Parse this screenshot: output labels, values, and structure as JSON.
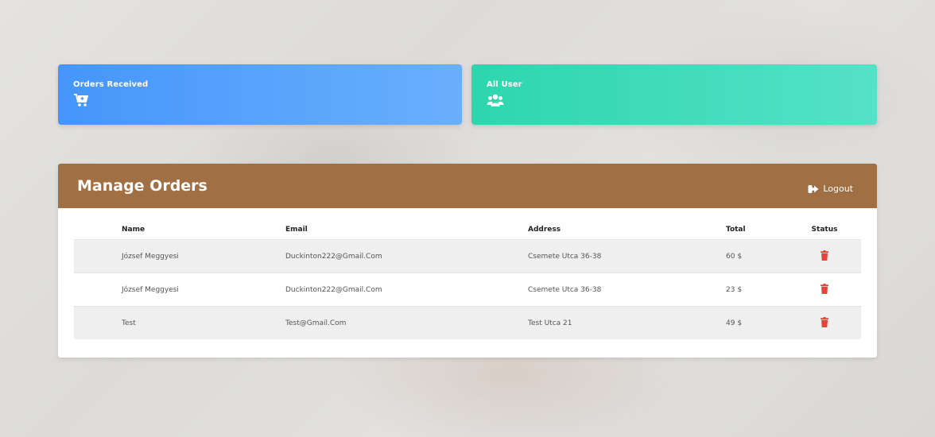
{
  "cards": {
    "orders_label": "Orders Received",
    "users_label": "All User"
  },
  "panel": {
    "title": "Manage Orders",
    "logout_label": "Logout"
  },
  "table": {
    "headers": {
      "name": "Name",
      "email": "Email",
      "address": "Address",
      "total": "Total",
      "status": "Status"
    },
    "rows": [
      {
        "name": "József Meggyesi",
        "email": "Duckinton222@Gmail.Com",
        "address": "Csemete Utca 36-38",
        "total": "60 $"
      },
      {
        "name": "József Meggyesi",
        "email": "Duckinton222@Gmail.Com",
        "address": "Csemete Utca 36-38",
        "total": "23 $"
      },
      {
        "name": "Test",
        "email": "Test@Gmail.Com",
        "address": "Test Utca 21",
        "total": "49 $"
      }
    ]
  },
  "icons": {
    "orders": "cart-plus-icon",
    "users": "users-icon",
    "logout": "sign-out-icon",
    "delete": "trash-icon"
  },
  "colors": {
    "orders_card": "#4596fb",
    "users_card": "#2dd6ad",
    "header": "#a06f43",
    "delete": "#e8433a"
  }
}
